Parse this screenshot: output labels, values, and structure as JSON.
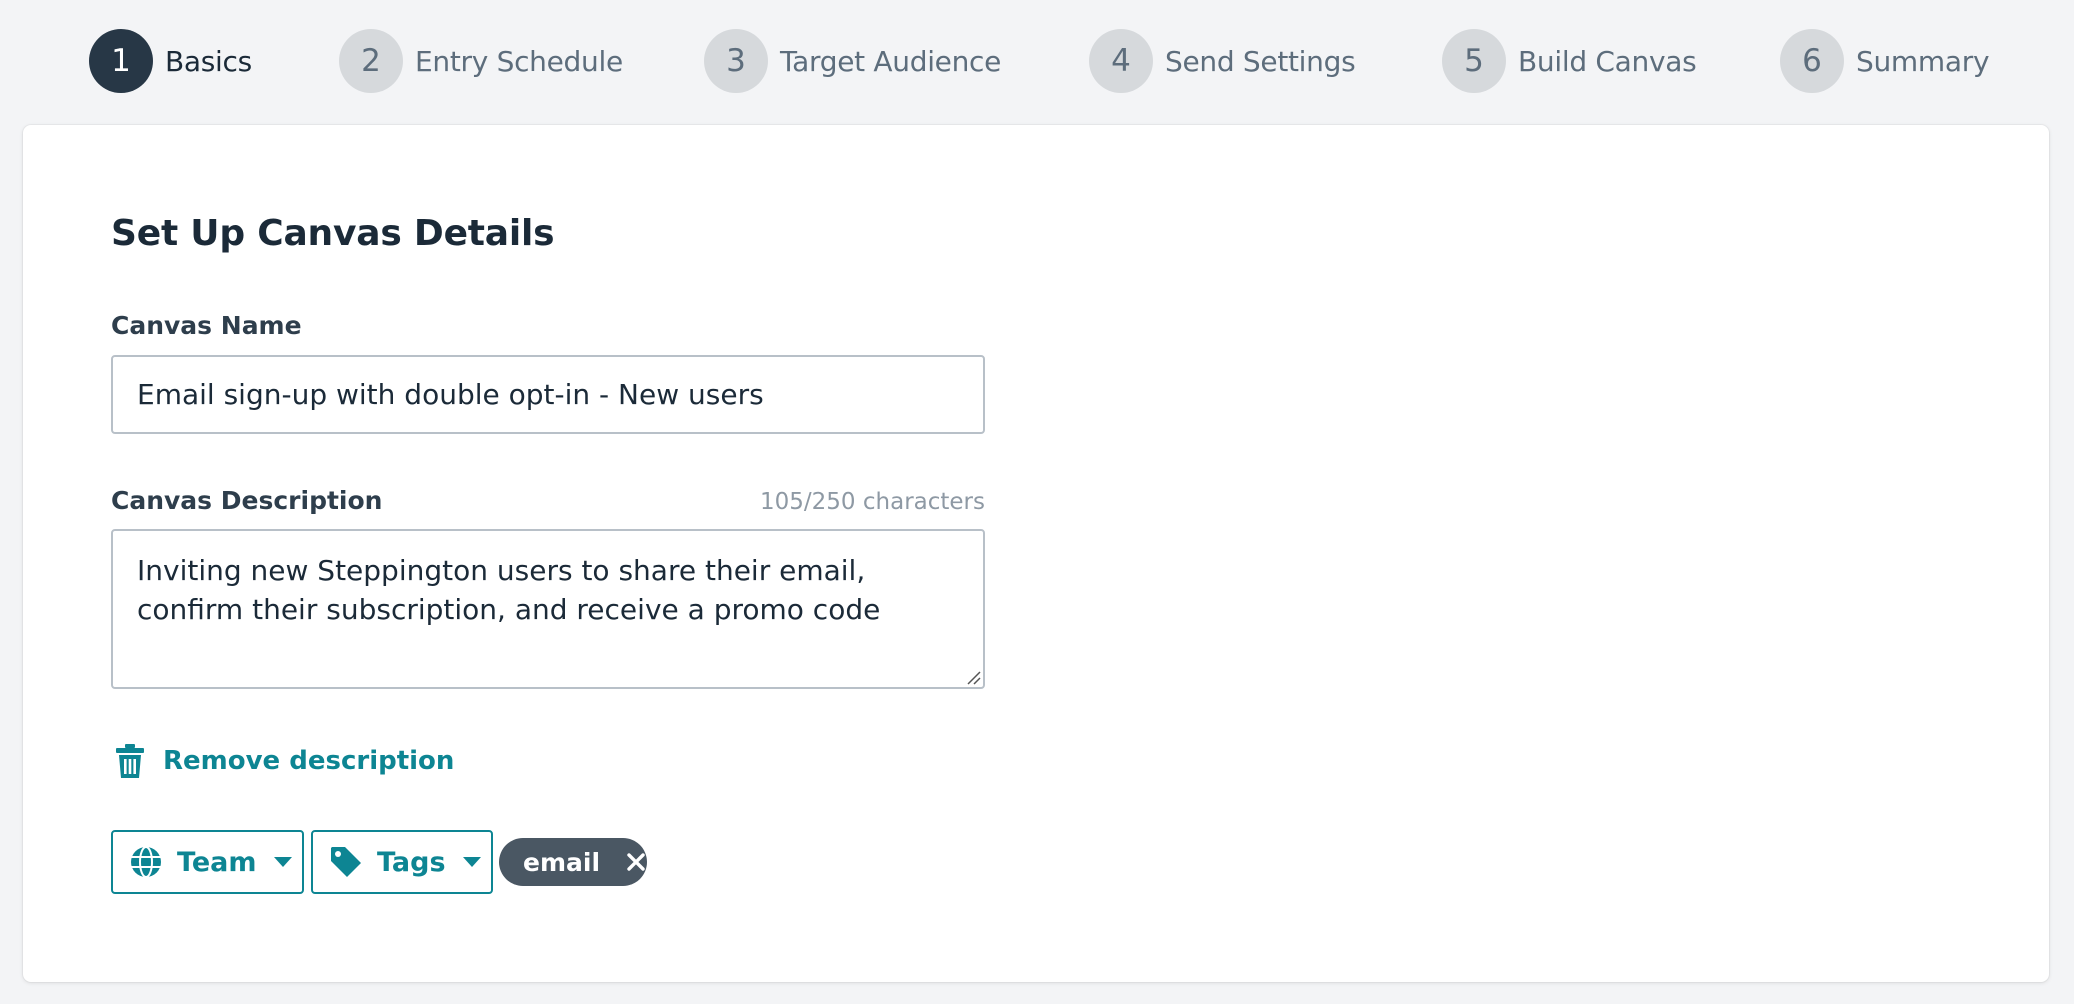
{
  "stepper": {
    "steps": [
      {
        "number": "1",
        "label": "Basics",
        "active": true
      },
      {
        "number": "2",
        "label": "Entry Schedule",
        "active": false
      },
      {
        "number": "3",
        "label": "Target Audience",
        "active": false
      },
      {
        "number": "4",
        "label": "Send Settings",
        "active": false
      },
      {
        "number": "5",
        "label": "Build Canvas",
        "active": false
      },
      {
        "number": "6",
        "label": "Summary",
        "active": false
      }
    ]
  },
  "form": {
    "title": "Set Up Canvas Details",
    "name_label": "Canvas Name",
    "name_value": "Email sign-up with double opt-in - New users",
    "description_label": "Canvas Description",
    "description_count": "105/250 characters",
    "description_value": "Inviting new Steppington users to share their email, confirm their subscription, and receive a promo code",
    "remove_description_label": "Remove description",
    "team_label": "Team",
    "tags_label": "Tags",
    "tag_chips": [
      "email"
    ]
  },
  "colors": {
    "accent": "#0d8593",
    "active_step": "#273746",
    "inactive_step": "#d6d9dc",
    "chip": "#4a5763"
  },
  "icons": {
    "remove": "trash-icon",
    "team": "globe-icon",
    "tags": "tag-icon",
    "dropdown": "caret-down-icon",
    "chip_remove": "close-icon"
  }
}
